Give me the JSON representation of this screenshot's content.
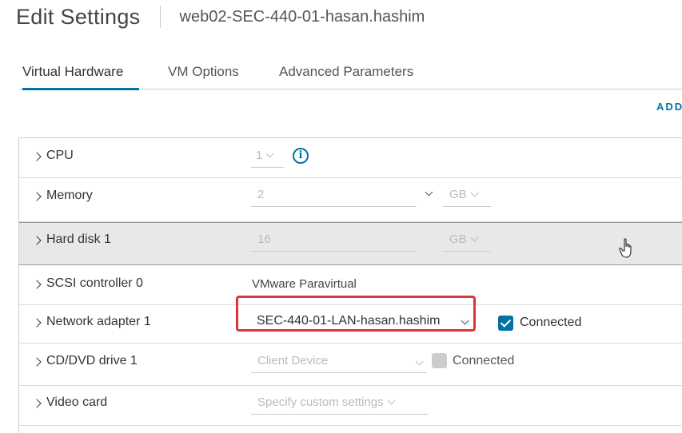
{
  "header": {
    "title": "Edit Settings",
    "vm_name": "web02-SEC-440-01-hasan.hashim"
  },
  "tabs": [
    {
      "label": "Virtual Hardware",
      "active": true
    },
    {
      "label": "VM Options",
      "active": false
    },
    {
      "label": "Advanced Parameters",
      "active": false
    }
  ],
  "add_link": "ADD",
  "accent_color": "#0072a3",
  "highlight_color": "#d9353b",
  "hardware": {
    "cpu": {
      "label": "CPU",
      "value": "1",
      "icon": "info-icon"
    },
    "memory": {
      "label": "Memory",
      "value": "2",
      "unit": "GB"
    },
    "hard_disk": {
      "label": "Hard disk 1",
      "value": "16",
      "unit": "GB"
    },
    "scsi": {
      "label": "SCSI controller 0",
      "value": "VMware Paravirtual"
    },
    "network": {
      "label": "Network adapter 1",
      "value": "SEC-440-01-LAN-hasan.hashim",
      "connected_label": "Connected",
      "connected": true
    },
    "cdrom": {
      "label": "CD/DVD drive 1",
      "value": "Client Device",
      "connected_label": "Connected",
      "connected": false
    },
    "video": {
      "label": "Video card",
      "value": "Specify custom settings"
    }
  }
}
